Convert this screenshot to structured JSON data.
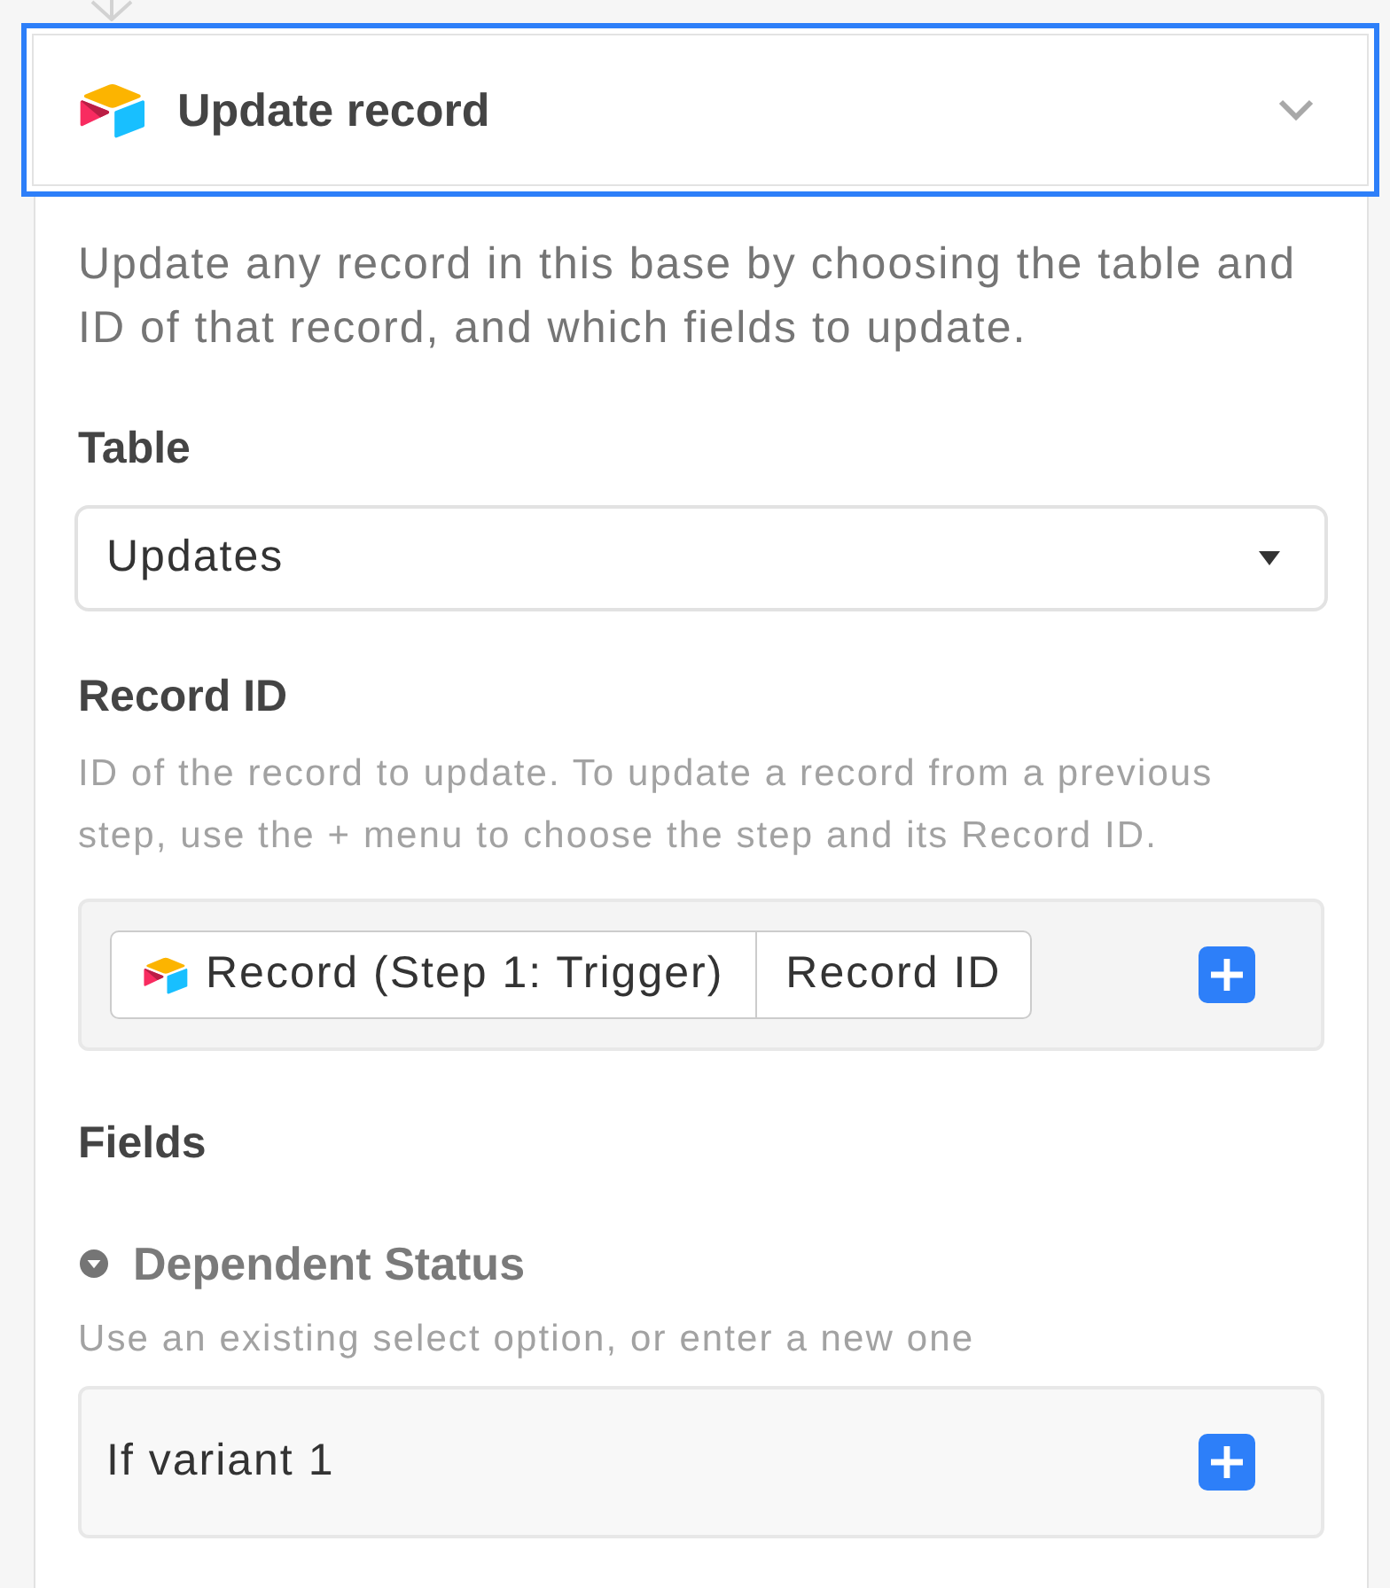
{
  "step": {
    "title": "Update record",
    "selected": true,
    "expanded": true
  },
  "description": "Update any record in this base by choosing the table and ID of that record, and which fields to update.",
  "table": {
    "label": "Table",
    "value": "Updates"
  },
  "record_id": {
    "label": "Record ID",
    "help": "ID of the record to update. To update a record from a previous step, use the + menu to choose the step and its Record ID.",
    "token": {
      "source": "Record (Step 1: Trigger)",
      "field": "Record ID"
    }
  },
  "fields": {
    "label": "Fields",
    "items": [
      {
        "kind": "select",
        "name": "Dependent Status",
        "help": "Use an existing select option, or enter a new one",
        "value": "If variant 1"
      }
    ]
  }
}
